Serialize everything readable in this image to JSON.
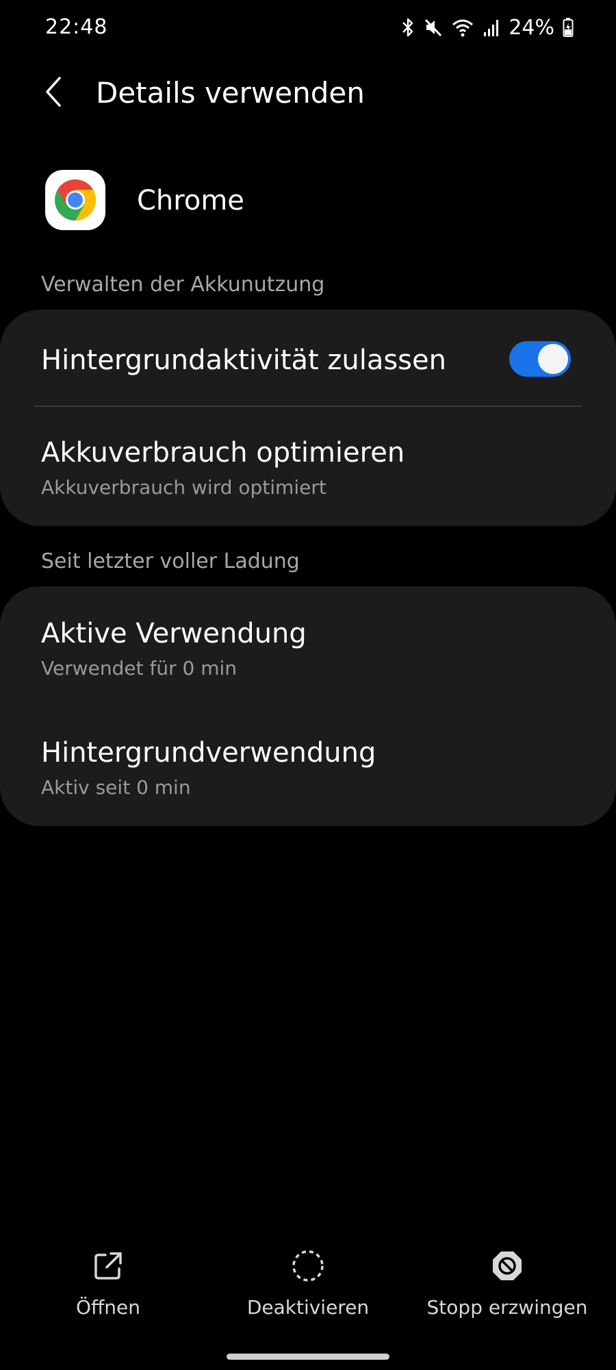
{
  "status_bar": {
    "time": "22:48",
    "battery_percent": "24%",
    "icons": [
      "bluetooth-icon",
      "mute-icon",
      "wifi-icon",
      "signal-icon",
      "battery-charging-icon"
    ]
  },
  "header": {
    "back_icon": "chevron-left-icon",
    "title": "Details verwenden"
  },
  "app": {
    "icon": "chrome-icon",
    "name": "Chrome"
  },
  "battery_section": {
    "header": "Verwalten der Akkunutzung",
    "background_activity": {
      "title": "Hintergrundaktivität zulassen",
      "enabled": true
    },
    "optimize": {
      "title": "Akkuverbrauch optimieren",
      "subtitle": "Akkuverbrauch wird optimiert"
    }
  },
  "usage_section": {
    "header": "Seit letzter voller Ladung",
    "active_use": {
      "title": "Aktive Verwendung",
      "subtitle": "Verwendet für 0 min"
    },
    "background_use": {
      "title": "Hintergrundverwendung",
      "subtitle": "Aktiv seit 0 min"
    }
  },
  "bottom_actions": {
    "open": {
      "label": "Öffnen",
      "icon": "open-external-icon"
    },
    "disable": {
      "label": "Deaktivieren",
      "icon": "dashed-circle-icon"
    },
    "force_stop": {
      "label": "Stopp erzwingen",
      "icon": "force-stop-icon"
    }
  },
  "colors": {
    "background": "#000000",
    "card": "#1c1c1c",
    "accent": "#1a73e8",
    "secondary_text": "#9a9a9a"
  }
}
